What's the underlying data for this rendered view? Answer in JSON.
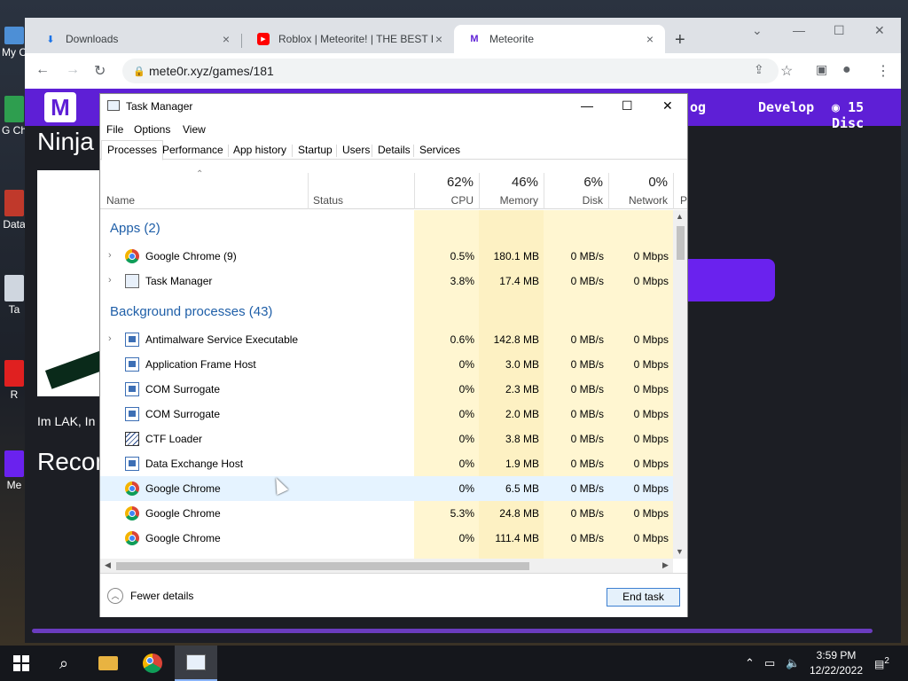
{
  "chrome": {
    "tabs": [
      {
        "title": "Downloads",
        "icon": "download-icon"
      },
      {
        "title": "Roblox | Meteorite! | THE BEST R",
        "icon": "youtube-icon"
      },
      {
        "title": "Meteorite",
        "icon": "meteorite-icon"
      }
    ],
    "url": "mete0r.xyz/games/181"
  },
  "site": {
    "logo": "M",
    "nav": [
      "og",
      "Develop",
      "15 Disc"
    ],
    "game_title": "Ninja",
    "description": "Im LAK, In",
    "recommended": "Recon",
    "desktop_labels": [
      "My C",
      "G\nCh",
      "Data",
      "Ta",
      "R",
      "Me"
    ]
  },
  "taskmanager": {
    "title": "Task Manager",
    "menu": [
      "File",
      "Options",
      "View"
    ],
    "tabs": [
      "Processes",
      "Performance",
      "App history",
      "Startup",
      "Users",
      "Details",
      "Services"
    ],
    "columns": {
      "name": "Name",
      "status": "Status",
      "cpu": {
        "pct": "62%",
        "label": "CPU"
      },
      "memory": {
        "pct": "46%",
        "label": "Memory"
      },
      "disk": {
        "pct": "6%",
        "label": "Disk"
      },
      "network": {
        "pct": "0%",
        "label": "Network"
      },
      "power": "P"
    },
    "groups": {
      "apps": "Apps (2)",
      "background": "Background processes (43)"
    },
    "apps": [
      {
        "name": "Google Chrome (9)",
        "cpu": "0.5%",
        "mem": "180.1 MB",
        "disk": "0 MB/s",
        "net": "0 Mbps"
      },
      {
        "name": "Task Manager",
        "cpu": "3.8%",
        "mem": "17.4 MB",
        "disk": "0 MB/s",
        "net": "0 Mbps"
      }
    ],
    "background": [
      {
        "name": "Antimalware Service Executable",
        "cpu": "0.6%",
        "mem": "142.8 MB",
        "disk": "0 MB/s",
        "net": "0 Mbps"
      },
      {
        "name": "Application Frame Host",
        "cpu": "0%",
        "mem": "3.0 MB",
        "disk": "0 MB/s",
        "net": "0 Mbps"
      },
      {
        "name": "COM Surrogate",
        "cpu": "0%",
        "mem": "2.3 MB",
        "disk": "0 MB/s",
        "net": "0 Mbps"
      },
      {
        "name": "COM Surrogate",
        "cpu": "0%",
        "mem": "2.0 MB",
        "disk": "0 MB/s",
        "net": "0 Mbps"
      },
      {
        "name": "CTF Loader",
        "cpu": "0%",
        "mem": "3.8 MB",
        "disk": "0 MB/s",
        "net": "0 Mbps"
      },
      {
        "name": "Data Exchange Host",
        "cpu": "0%",
        "mem": "1.9 MB",
        "disk": "0 MB/s",
        "net": "0 Mbps"
      },
      {
        "name": "Google Chrome",
        "cpu": "0%",
        "mem": "6.5 MB",
        "disk": "0 MB/s",
        "net": "0 Mbps"
      },
      {
        "name": "Google Chrome",
        "cpu": "5.3%",
        "mem": "24.8 MB",
        "disk": "0 MB/s",
        "net": "0 Mbps"
      },
      {
        "name": "Google Chrome",
        "cpu": "0%",
        "mem": "111.4 MB",
        "disk": "0 MB/s",
        "net": "0 Mbps"
      }
    ],
    "fewer_details": "Fewer details",
    "end_task": "End task"
  },
  "taskbar": {
    "time": "3:59 PM",
    "date": "12/22/2022",
    "notifications": "2"
  }
}
